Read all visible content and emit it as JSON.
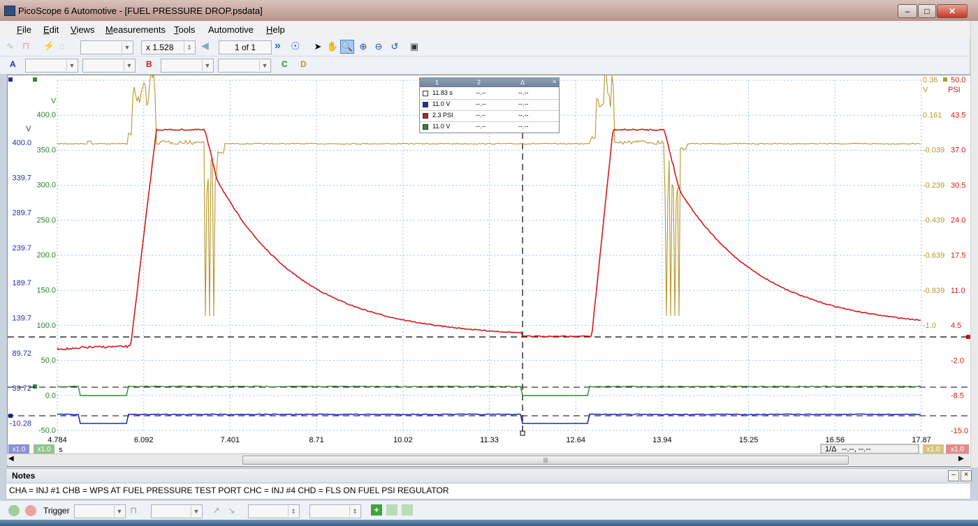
{
  "window": {
    "title": "PicoScope 6 Automotive - [FUEL PRESSURE DROP.psdata]",
    "buttons": {
      "minimize": "–",
      "maximize": "□",
      "close": "✕"
    }
  },
  "menu": [
    {
      "u": "F",
      "rest": "ile"
    },
    {
      "u": "E",
      "rest": "dit"
    },
    {
      "u": "V",
      "rest": "iews"
    },
    {
      "u": "M",
      "rest": "easurements"
    },
    {
      "u": "T",
      "rest": "ools"
    },
    {
      "u": "",
      "rest": "Automotive"
    },
    {
      "u": "H",
      "rest": "elp"
    }
  ],
  "toolbar": {
    "zoom_value": "x 1.528",
    "page_value": "1 of 1"
  },
  "channel_labels": {
    "a": "A",
    "b": "B",
    "c": "C",
    "d": "D"
  },
  "measurements": {
    "headers": [
      "1",
      "2",
      "Δ"
    ],
    "rows": [
      {
        "color": "#ffffff",
        "v1": "11.83 s",
        "v2": "--.--",
        "delta": "--.--"
      },
      {
        "color": "#1f2fa8",
        "v1": "11.0 V",
        "v2": "--.--",
        "delta": "--.--"
      },
      {
        "color": "#d11a1a",
        "v1": "2.3 PSI",
        "v2": "--.--",
        "delta": "--.--"
      },
      {
        "color": "#2e8b2e",
        "v1": "11.0 V",
        "v2": "--.--",
        "delta": "--.--"
      }
    ]
  },
  "chart_data": {
    "type": "line",
    "x_unit": "s",
    "x_ticks": [
      "4.784",
      "6.092",
      "7.401",
      "8.71",
      "10.02",
      "11.33",
      "12.64",
      "13.94",
      "15.25",
      "16.56",
      "17.87"
    ],
    "xlim": [
      4.784,
      17.87
    ],
    "axes": {
      "green": {
        "unit": "V",
        "ticks": [
          "400.0",
          "350.0",
          "300.0",
          "250.0",
          "200.0",
          "150.0",
          "100.0",
          "50.0",
          "0.0",
          "-50.0"
        ],
        "color": "#2e7d2e"
      },
      "blue": {
        "unit": "V",
        "ticks": [
          "400.0",
          "339.7",
          "289.7",
          "239.7",
          "189.7",
          "139.7",
          "89.72",
          "39.72",
          "-10.28"
        ],
        "color": "#1f2fa8"
      },
      "gold": {
        "unit": "V",
        "ticks": [
          "0.36",
          "0.161",
          "-0.039",
          "-0.239",
          "-0.439",
          "-0.639",
          "-0.839",
          "-1.0"
        ],
        "color": "#b8962e"
      },
      "red": {
        "unit": "PSI",
        "ticks": [
          "50.0",
          "43.5",
          "37.0",
          "30.5",
          "24.0",
          "17.5",
          "11.0",
          "4.5",
          "-2.0",
          "-8.5",
          "-15.0"
        ],
        "color": "#d11a1a"
      }
    },
    "cursor_x": 11.83,
    "bottom_tags": {
      "left_blue": "x1.0",
      "left_green": "x1.0",
      "right_gold": "x1.0",
      "right_red": "x1.0",
      "delta_label": "1/Δ",
      "delta_value": "--.--, --.--"
    },
    "grid": true
  },
  "notes": {
    "title": "Notes",
    "text": "CHA = INJ #1   CHB = WPS AT FUEL PRESSURE TEST PORT   CHC = INJ #4    CHD = FLS ON FUEL PSI REGULATOR"
  },
  "triggerbar": {
    "label": "Trigger"
  },
  "colors": {
    "red": "#d11a1a",
    "gold": "#b8962e",
    "green": "#2e8b2e",
    "blue": "#1f2fa8",
    "grid": "#9fc6e6"
  }
}
